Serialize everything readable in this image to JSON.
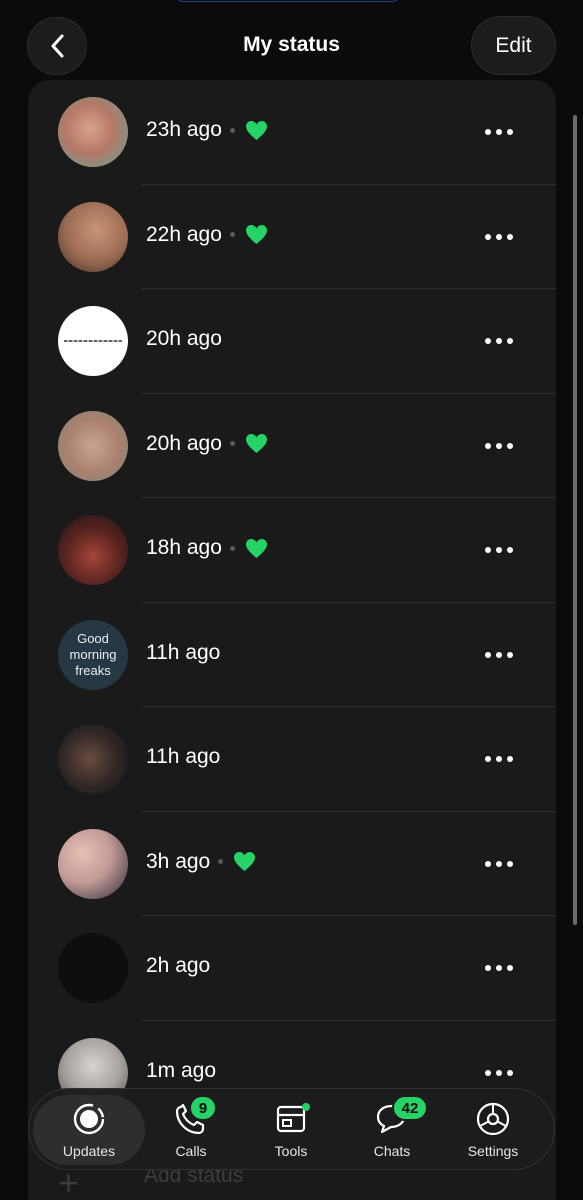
{
  "header": {
    "title": "My status",
    "edit_label": "Edit"
  },
  "statuses": [
    {
      "time": "23h ago",
      "liked": true,
      "thumb": "photo-skin"
    },
    {
      "time": "22h ago",
      "liked": true,
      "thumb": "photo-hand-bracelet"
    },
    {
      "time": "20h ago",
      "liked": false,
      "thumb": "white-text-image"
    },
    {
      "time": "20h ago",
      "liked": true,
      "thumb": "photo-hands"
    },
    {
      "time": "18h ago",
      "liked": true,
      "thumb": "photo-dark-red"
    },
    {
      "time": "11h ago",
      "liked": false,
      "thumb": "text-status",
      "thumb_text": "Good morning freaks"
    },
    {
      "time": "11h ago",
      "liked": false,
      "thumb": "photo-dark-room"
    },
    {
      "time": "3h ago",
      "liked": true,
      "thumb": "photo-skin-blurred"
    },
    {
      "time": "2h ago",
      "liked": false,
      "thumb": "black-image"
    },
    {
      "time": "1m ago",
      "liked": false,
      "thumb": "photo-grey"
    }
  ],
  "add_status": {
    "label": "Add status"
  },
  "tabs": [
    {
      "label": "Updates",
      "icon": "updates-icon",
      "active": true
    },
    {
      "label": "Calls",
      "icon": "phone-icon",
      "badge": "9"
    },
    {
      "label": "Tools",
      "icon": "storefront-icon",
      "dot": true
    },
    {
      "label": "Chats",
      "icon": "chat-bubbles-icon",
      "badge": "42"
    },
    {
      "label": "Settings",
      "icon": "gear-icon"
    }
  ],
  "colors": {
    "accent": "#25d366",
    "background": "#0b0b0b",
    "card": "#1a1a1a"
  }
}
